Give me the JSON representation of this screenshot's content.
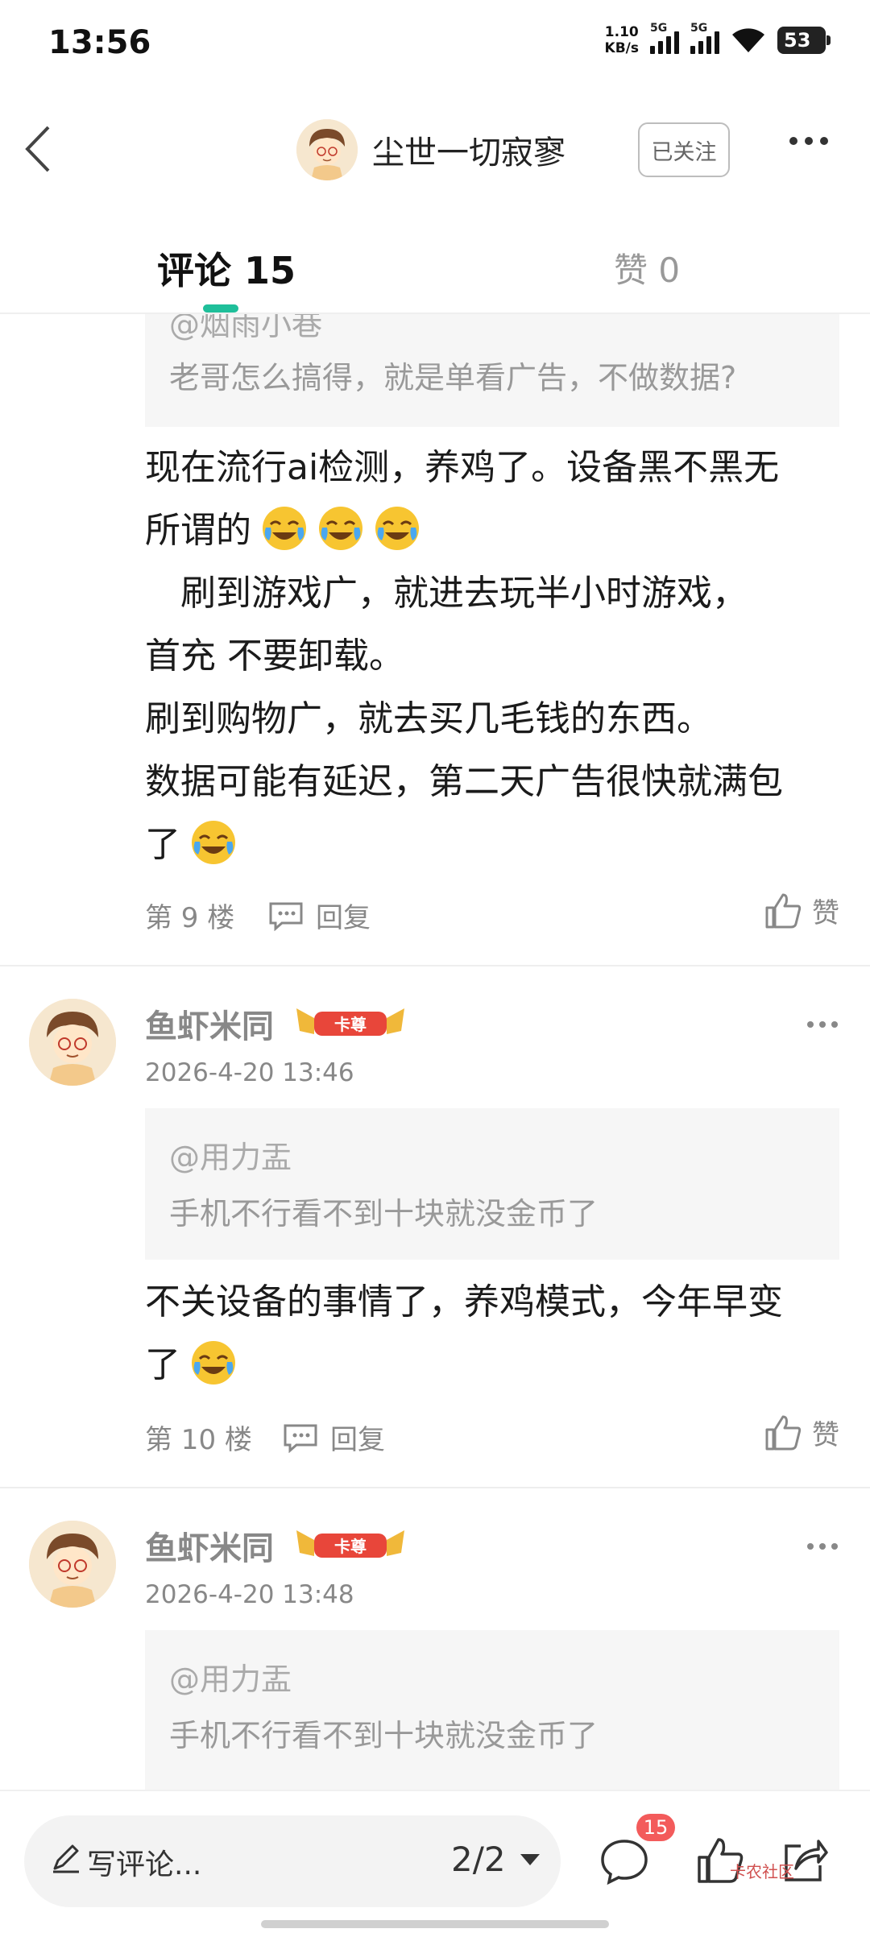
{
  "status_bar": {
    "time": "13:56",
    "net_speed_value": "1.10",
    "net_speed_unit": "KB/s",
    "signal_1_label": "5G",
    "signal_2_label": "5G",
    "battery": "53"
  },
  "header": {
    "username": "尘世一切寂寥",
    "follow_label": "已关注"
  },
  "tabs": {
    "comments_label": "评论 15",
    "likes_label": "赞 0"
  },
  "reply_9": {
    "quote_mention": "@烟雨小巷",
    "quote_text": "老哥怎么搞得，就是单看广告，不做数据?",
    "body_line1": "现在流行ai检测，养鸡了。设备黑不黑无",
    "body_line2": "所谓的",
    "body_line3": "　刷到游戏广，就进去玩半小时游戏，",
    "body_line4": "首充 不要卸载。",
    "body_line5": "刷到购物广，就去买几毛钱的东西。",
    "body_line6": "数据可能有延迟，第二天广告很快就满包",
    "body_line7": "了",
    "floor": "第 9 楼",
    "reply_label": "回复",
    "like_label": "赞"
  },
  "reply_10": {
    "name": "鱼虾米同",
    "badge": "卡尊",
    "time": "2026-4-20 13:46",
    "quote_mention": "@用力盂",
    "quote_text": "手机不行看不到十块就没金币了",
    "body_line1": "不关设备的事情了，养鸡模式，今年早变",
    "body_line2": "了",
    "floor": "第 10 楼",
    "reply_label": "回复",
    "like_label": "赞"
  },
  "reply_11": {
    "name": "鱼虾米同",
    "badge": "卡尊",
    "time": "2026-4-20 13:48",
    "quote_mention": "@用力盂",
    "quote_text": "手机不行看不到十块就没金币了"
  },
  "bottom_bar": {
    "input_placeholder": "写评论...",
    "page_indicator": "2/2",
    "comment_count": "15",
    "watermark": "卡农社区"
  },
  "colors": {
    "accent": "#1fbf9a",
    "badge_red": "#f35b5b",
    "gold_badge": "#e8a92a"
  },
  "icons": [
    "back-arrow-icon",
    "more-icon",
    "comment-icon",
    "like-icon",
    "share-icon",
    "pen-icon",
    "laugh-cry-emoji-icon",
    "reply-icon"
  ]
}
